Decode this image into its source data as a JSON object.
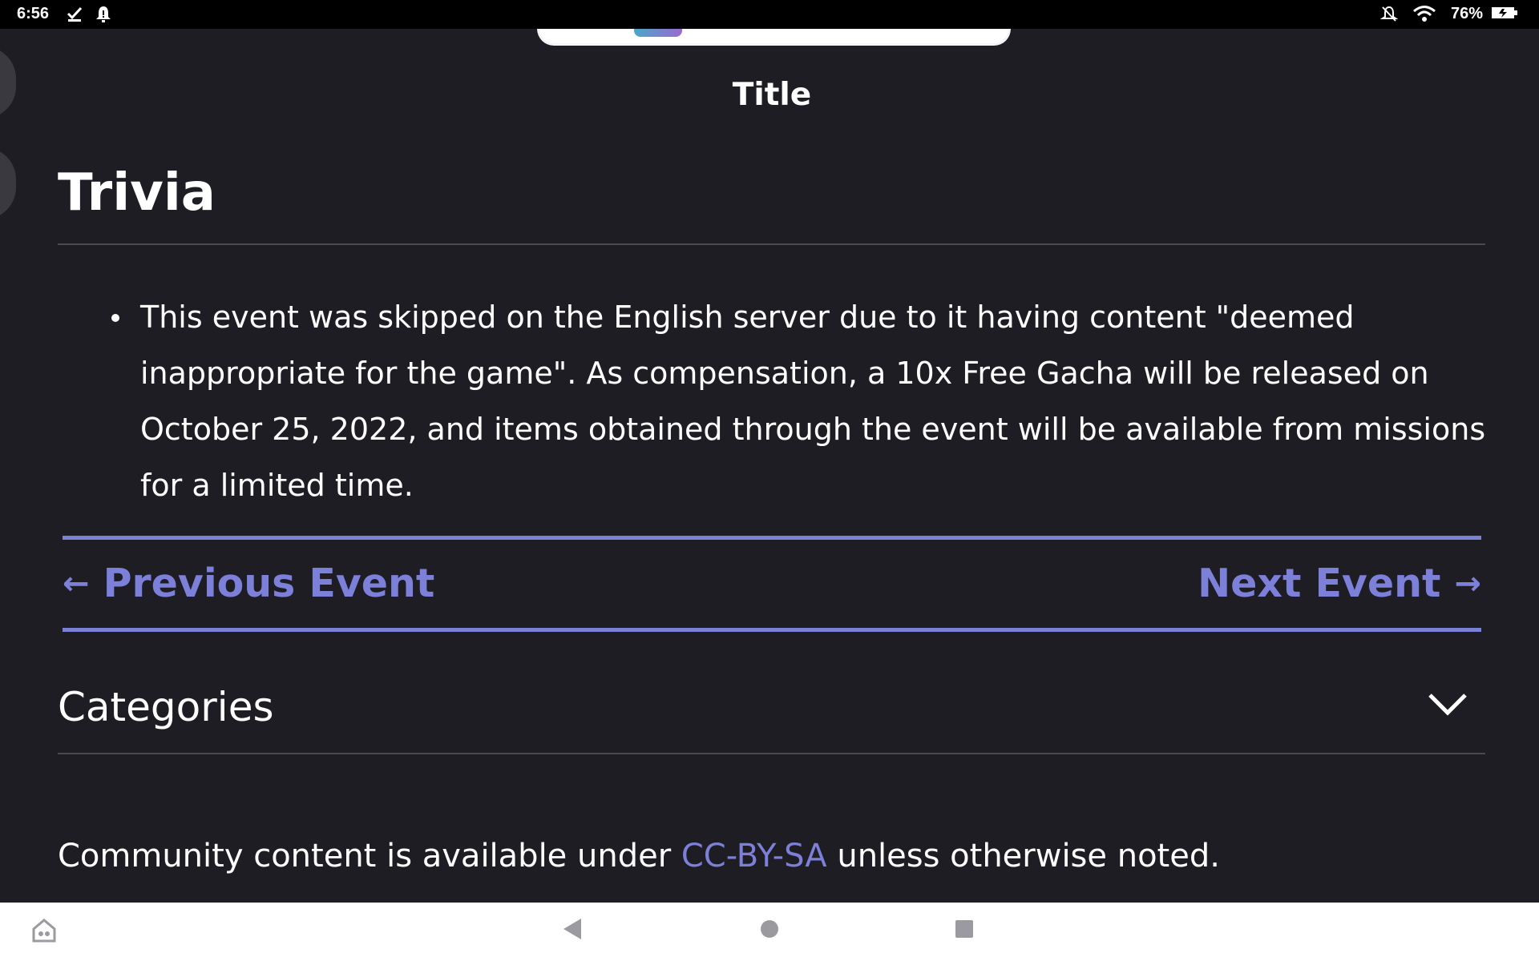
{
  "status_bar": {
    "time": "6:56",
    "battery_percent": "76%",
    "left_icons": [
      "checkmark-download-icon",
      "bell-alert-icon"
    ],
    "right_icons": [
      "mute-bell-icon",
      "wifi-icon",
      "battery-charging-icon"
    ]
  },
  "image": {
    "caption": "Title"
  },
  "trivia": {
    "heading": "Trivia",
    "items": [
      "This event was skipped on the English server due to it having content \"deemed inappropriate for the game\". As compensation, a 10x Free Gacha will be released on October 25, 2022, and items obtained through the event will be available from missions for a limited time."
    ]
  },
  "event_nav": {
    "prev_label": "Previous Event",
    "next_label": "Next Event",
    "prev_arrow": "←",
    "next_arrow": "→"
  },
  "categories": {
    "label": "Categories"
  },
  "footer": {
    "text_before": "Community content is available under ",
    "link_text": "CC-BY-SA",
    "text_after": " unless otherwise noted."
  },
  "colors": {
    "background": "#1f1d24",
    "accent": "#7c80d8",
    "text": "#ffffff",
    "divider": "#4a4950"
  },
  "navigation_bar": {
    "buttons": [
      "home-app-icon",
      "back-icon",
      "home-icon",
      "recents-icon"
    ]
  }
}
